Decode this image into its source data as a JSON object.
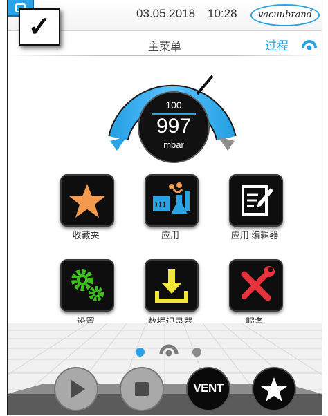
{
  "status_bar": {
    "date": "03.05.2018",
    "time": "10:28",
    "brand_logo": "vacuubrand"
  },
  "header": {
    "title": "主菜单",
    "process_label": "过程"
  },
  "gauge": {
    "setpoint": "100",
    "value": "997",
    "unit": "mbar"
  },
  "tiles": [
    {
      "label": "收藏夹",
      "icon": "star-icon"
    },
    {
      "label": "应用",
      "icon": "application-icon"
    },
    {
      "label": "应用 编辑器",
      "icon": "editor-icon"
    },
    {
      "label": "设置",
      "icon": "gears-icon"
    },
    {
      "label": "数据记录器",
      "icon": "download-icon"
    },
    {
      "label": "服务",
      "icon": "tools-icon"
    }
  ],
  "pager": {
    "pages": 3,
    "active": 1
  },
  "controls": {
    "vent_label": "VENT"
  },
  "colors": {
    "accent": "#2aa3e6",
    "star": "#f39a4e",
    "green": "#3fbf1f",
    "yellow": "#f2e63a",
    "red": "#e8323c"
  }
}
